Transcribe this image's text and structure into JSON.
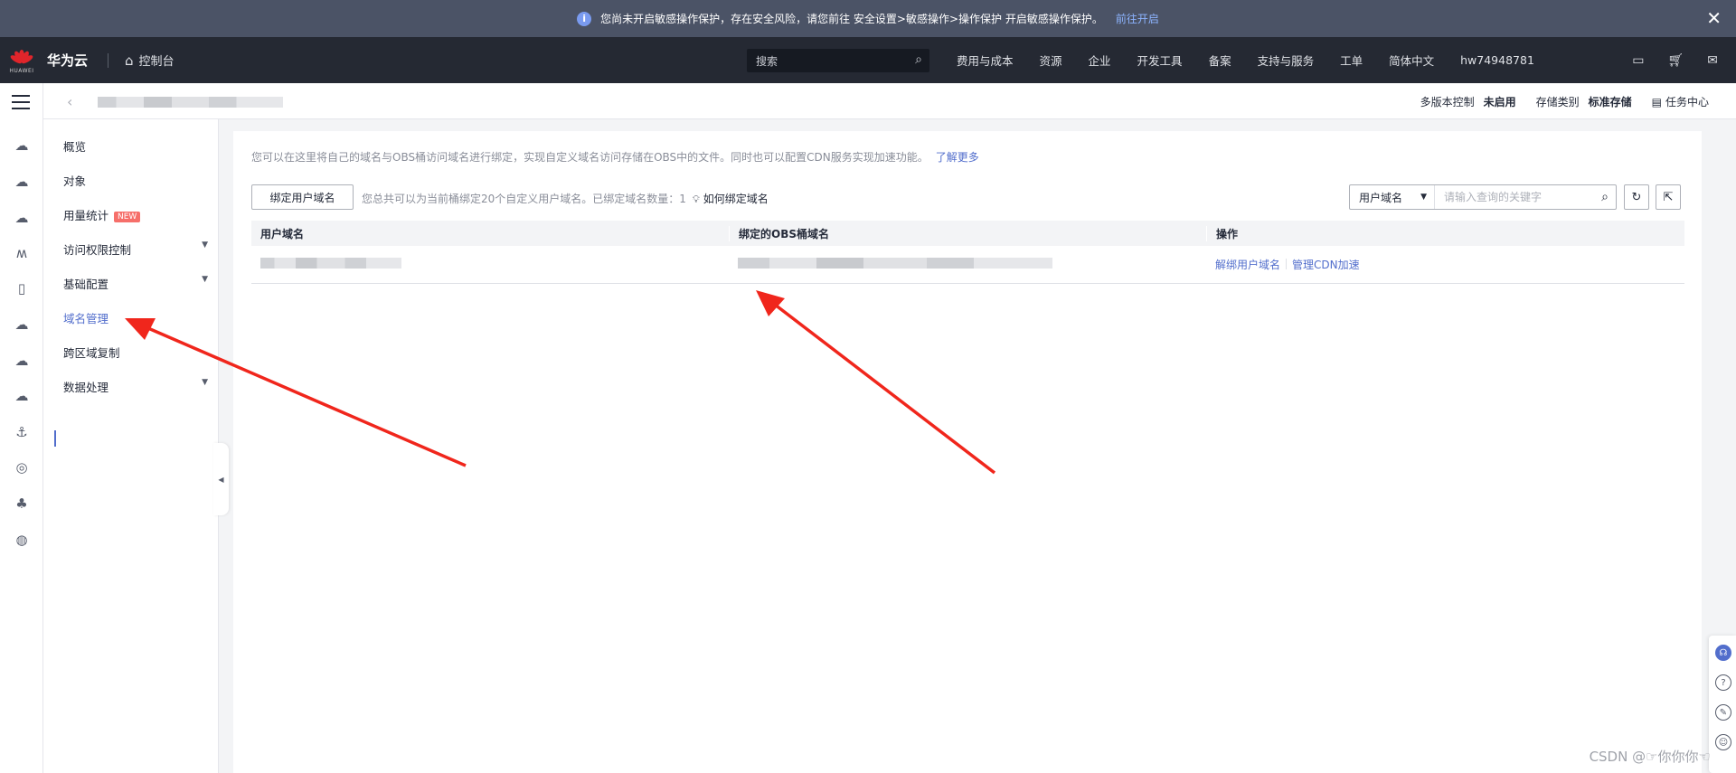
{
  "notice": {
    "text": "您尚未开启敏感操作保护，存在安全风险，请您前往 安全设置>敏感操作>操作保护 开启敏感操作保护。",
    "link": "前往开启",
    "info_glyph": "i",
    "close_glyph": "✕"
  },
  "topnav": {
    "logo_word": "HUAWEI",
    "brand": "华为云",
    "console": "控制台",
    "search_placeholder": "搜索",
    "links": [
      "费用与成本",
      "资源",
      "企业",
      "开发工具",
      "备案",
      "支持与服务",
      "工单",
      "简体中文",
      "hw74948781"
    ],
    "icons": [
      "terminal-icon",
      "cart-icon",
      "mail-icon"
    ]
  },
  "subhead": {
    "versioning_label": "多版本控制",
    "versioning_value": "未启用",
    "storage_label": "存储类别",
    "storage_value": "标准存储",
    "task_center": "任务中心"
  },
  "sidemenu": {
    "items": [
      {
        "label": "概览",
        "arrow": false
      },
      {
        "label": "对象",
        "arrow": false
      },
      {
        "label": "用量统计",
        "badge": "NEW",
        "arrow": false
      },
      {
        "label": "访问权限控制",
        "arrow": true
      },
      {
        "label": "基础配置",
        "arrow": true
      },
      {
        "label": "域名管理",
        "arrow": false,
        "active": true
      },
      {
        "label": "跨区域复制",
        "arrow": false
      },
      {
        "label": "数据处理",
        "arrow": true
      }
    ]
  },
  "main": {
    "description": "您可以在这里将自己的域名与OBS桶访问域名进行绑定，实现自定义域名访问存储在OBS中的文件。同时也可以配置CDN服务实现加速功能。",
    "learn_more": "了解更多",
    "bind_button": "绑定用户域名",
    "quota_text": "您总共可以为当前桶绑定20个自定义用户域名。已绑定域名数量：1",
    "howto": "如何绑定域名",
    "filter_select": "用户域名",
    "filter_placeholder": "请输入查询的关键字",
    "table": {
      "headers": [
        "用户域名",
        "绑定的OBS桶域名",
        "操作"
      ],
      "row_actions": [
        "解绑用户域名",
        "管理CDN加速"
      ]
    }
  },
  "colors": {
    "accent": "#526ecc",
    "annotation_arrow": "#f0261c",
    "nav_bg": "#252933",
    "notice_bg": "#4b5366"
  },
  "watermark": "CSDN @☞你你你☜"
}
